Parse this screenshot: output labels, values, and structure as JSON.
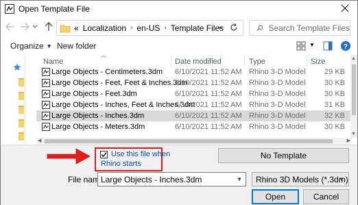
{
  "window": {
    "title": "Open Template File"
  },
  "address": {
    "breadcrumbs": [
      "«",
      "Localization",
      "en-US",
      "Template Files"
    ],
    "separators": [
      "›",
      "›"
    ]
  },
  "search": {
    "placeholder": "Search Template Files"
  },
  "toolbar": {
    "organize_label": "Organize",
    "new_folder_label": "New folder"
  },
  "columns": {
    "name": "Name",
    "date": "Date modified",
    "type": "Type",
    "size": "Size"
  },
  "files": [
    {
      "name": "Large Objects - Centimeters.3dm",
      "date": "6/10/2021 11:52 AM",
      "type": "Rhino 3-D Model",
      "size": "29 KB",
      "selected": false
    },
    {
      "name": "Large Objects - Feet, Feet & Inches.3dm",
      "date": "6/10/2021 11:52 AM",
      "type": "Rhino 3-D Model",
      "size": "30 KB",
      "selected": false
    },
    {
      "name": "Large Objects - Feet.3dm",
      "date": "6/10/2021 11:52 AM",
      "type": "Rhino 3-D Model",
      "size": "30 KB",
      "selected": false
    },
    {
      "name": "Large Objects - Inches, Feet & Inches.3dm",
      "date": "6/10/2021 11:52 AM",
      "type": "Rhino 3-D Model",
      "size": "31 KB",
      "selected": false
    },
    {
      "name": "Large Objects - Inches.3dm",
      "date": "6/10/2021 11:52 AM",
      "type": "Rhino 3-D Model",
      "size": "32 KB",
      "selected": true
    },
    {
      "name": "Large Objects - Meters.3dm",
      "date": "6/10/2021 11:52 AM",
      "type": "Rhino 3-D Model",
      "size": "30 KB",
      "selected": false
    }
  ],
  "startup_option": {
    "checked": true,
    "label_line1": "Use this file when",
    "label_line2": "Rhino starts"
  },
  "no_template_label": "No Template",
  "file_name": {
    "label": "File name:",
    "value": "Large Objects - Inches.3dm"
  },
  "file_type": {
    "value": "Rhino 3D Models (*.3dm)"
  },
  "open_label": "Open",
  "cancel_label": "Cancel",
  "colors": {
    "annotation_red": "#e31b1b",
    "accent_blue": "#0078d7",
    "link_blue": "#0a4ea6",
    "selected_row": "#d9d9d9"
  }
}
